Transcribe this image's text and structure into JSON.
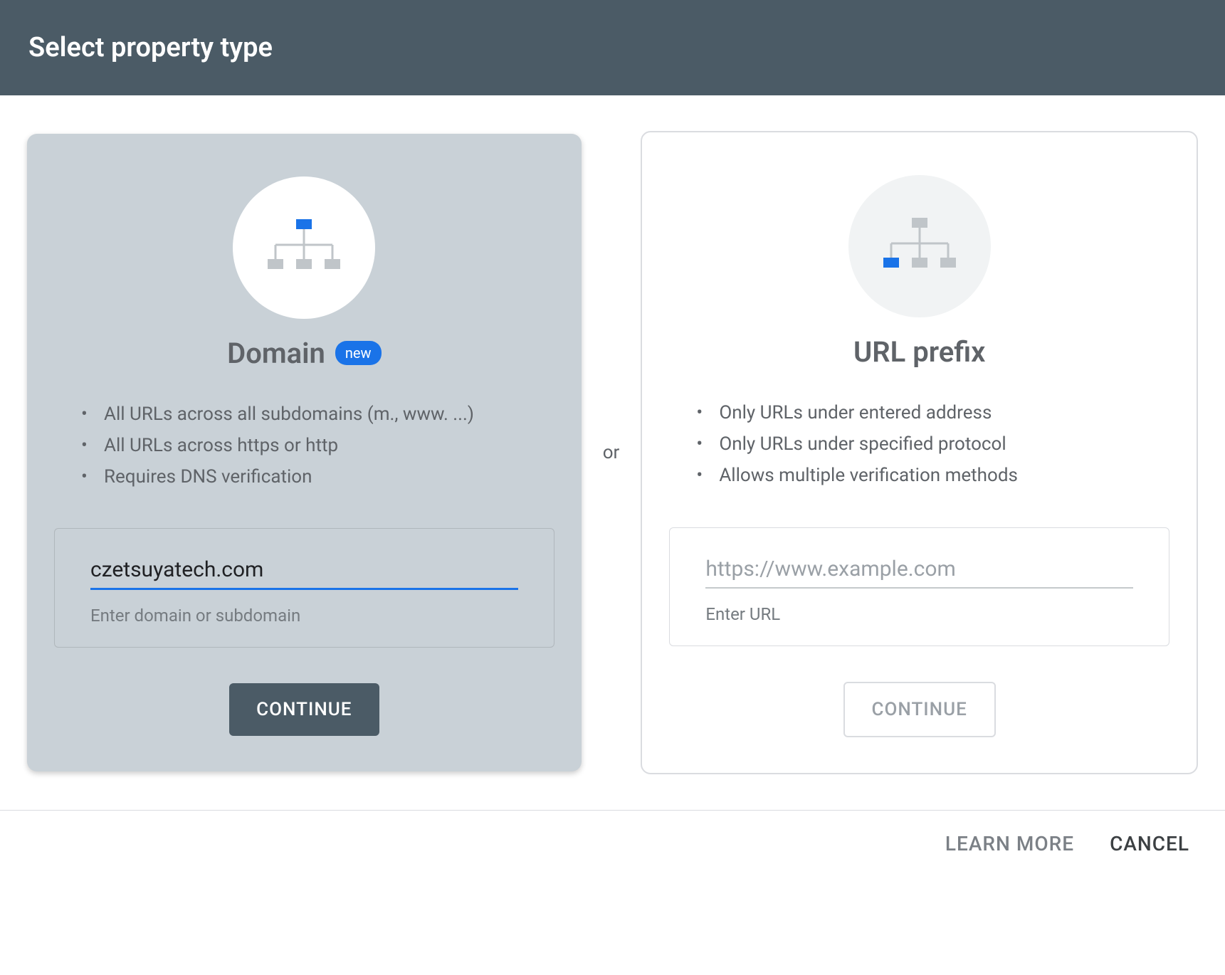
{
  "header": {
    "title": "Select property type"
  },
  "divider": "or",
  "domain_card": {
    "title": "Domain",
    "badge": "new",
    "features": [
      "All URLs across all subdomains (m., www. ...)",
      "All URLs across https or http",
      "Requires DNS verification"
    ],
    "input_value": "czetsuyatech.com",
    "input_helper": "Enter domain or subdomain",
    "continue": "CONTINUE"
  },
  "url_card": {
    "title": "URL prefix",
    "features": [
      "Only URLs under entered address",
      "Only URLs under specified protocol",
      "Allows multiple verification methods"
    ],
    "input_placeholder": "https://www.example.com",
    "input_helper": "Enter URL",
    "continue": "CONTINUE"
  },
  "footer": {
    "learn_more": "LEARN MORE",
    "cancel": "CANCEL"
  }
}
